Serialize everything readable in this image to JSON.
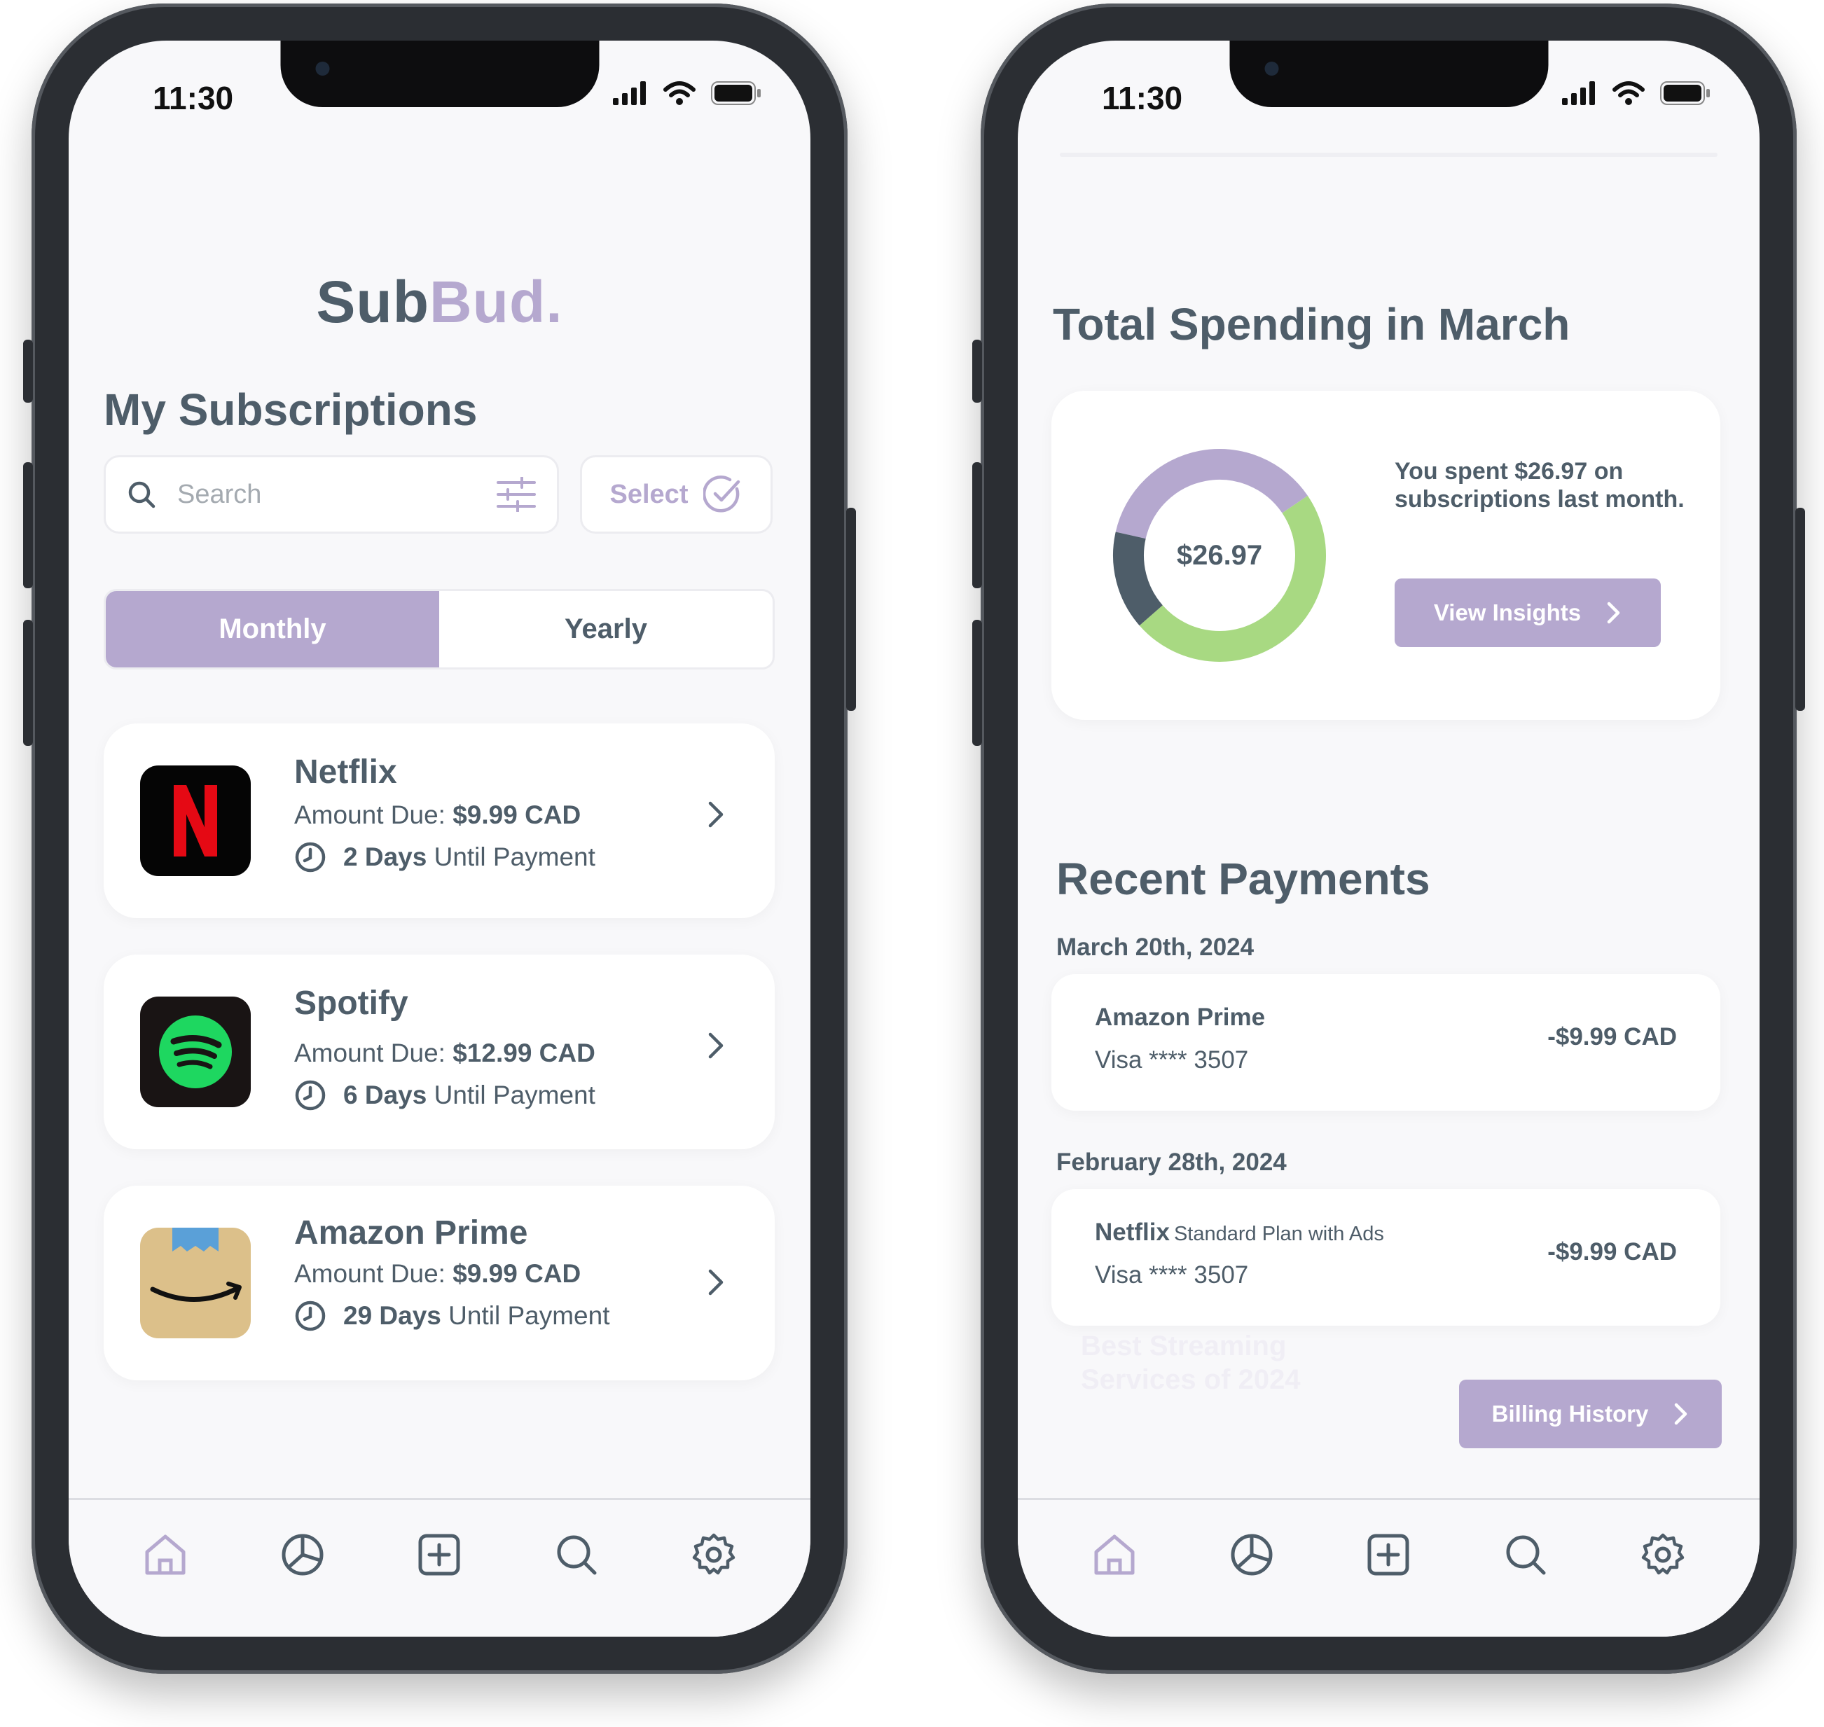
{
  "status": {
    "time": "11:30"
  },
  "left": {
    "logo": {
      "main": "Sub",
      "accent": "Bud."
    },
    "title": "My Subscriptions",
    "search": {
      "placeholder": "Search"
    },
    "select_label": "Select",
    "toggle": {
      "monthly": "Monthly",
      "yearly": "Yearly",
      "active": "Monthly"
    },
    "subscriptions": [
      {
        "name": "Netflix",
        "due_prefix": "Amount Due: ",
        "amount": "$9.99 CAD",
        "days": "2 Days",
        "days_suffix": " Until Payment",
        "icon": "netflix-icon"
      },
      {
        "name": "Spotify",
        "due_prefix": "Amount Due: ",
        "amount": "$12.99 CAD",
        "days": "6 Days",
        "days_suffix": " Until Payment",
        "icon": "spotify-icon"
      },
      {
        "name": "Amazon Prime",
        "due_prefix": "Amount Due: ",
        "amount": "$9.99 CAD",
        "days": "29 Days",
        "days_suffix": " Until Payment",
        "icon": "amazon-icon"
      }
    ]
  },
  "right": {
    "spending_title": "Total Spending in March",
    "total": "$26.97",
    "summary": "You spent $26.97 on subscriptions last month.",
    "view_insights": "View Insights",
    "recent_title": "Recent Payments",
    "payments": [
      {
        "date": "March 20th, 2024",
        "name": "Amazon Prime",
        "plan": "",
        "card": "Visa **** 3507",
        "amount": "-$9.99 CAD"
      },
      {
        "date": "February 28th, 2024",
        "name": "Netflix",
        "plan": "Standard Plan with Ads",
        "card": "Visa **** 3507",
        "amount": "-$9.99 CAD"
      }
    ],
    "billing_history": "Billing History",
    "faded_promo": "Best Streaming Services of 2024"
  },
  "donut": {
    "segments": [
      {
        "label": "Amazon Prime",
        "share": 0.37,
        "color": "#b5a8cf"
      },
      {
        "label": "Spotify",
        "share": 0.48,
        "color": "#a8d982"
      },
      {
        "label": "Netflix",
        "share": 0.15,
        "color": "#4e5d69"
      }
    ]
  },
  "colors": {
    "accent": "#b5a8cf",
    "text": "#4e5d69",
    "green": "#a8d982"
  },
  "tabs": [
    "home-icon",
    "chart-icon",
    "add-icon",
    "search-icon",
    "settings-icon"
  ]
}
